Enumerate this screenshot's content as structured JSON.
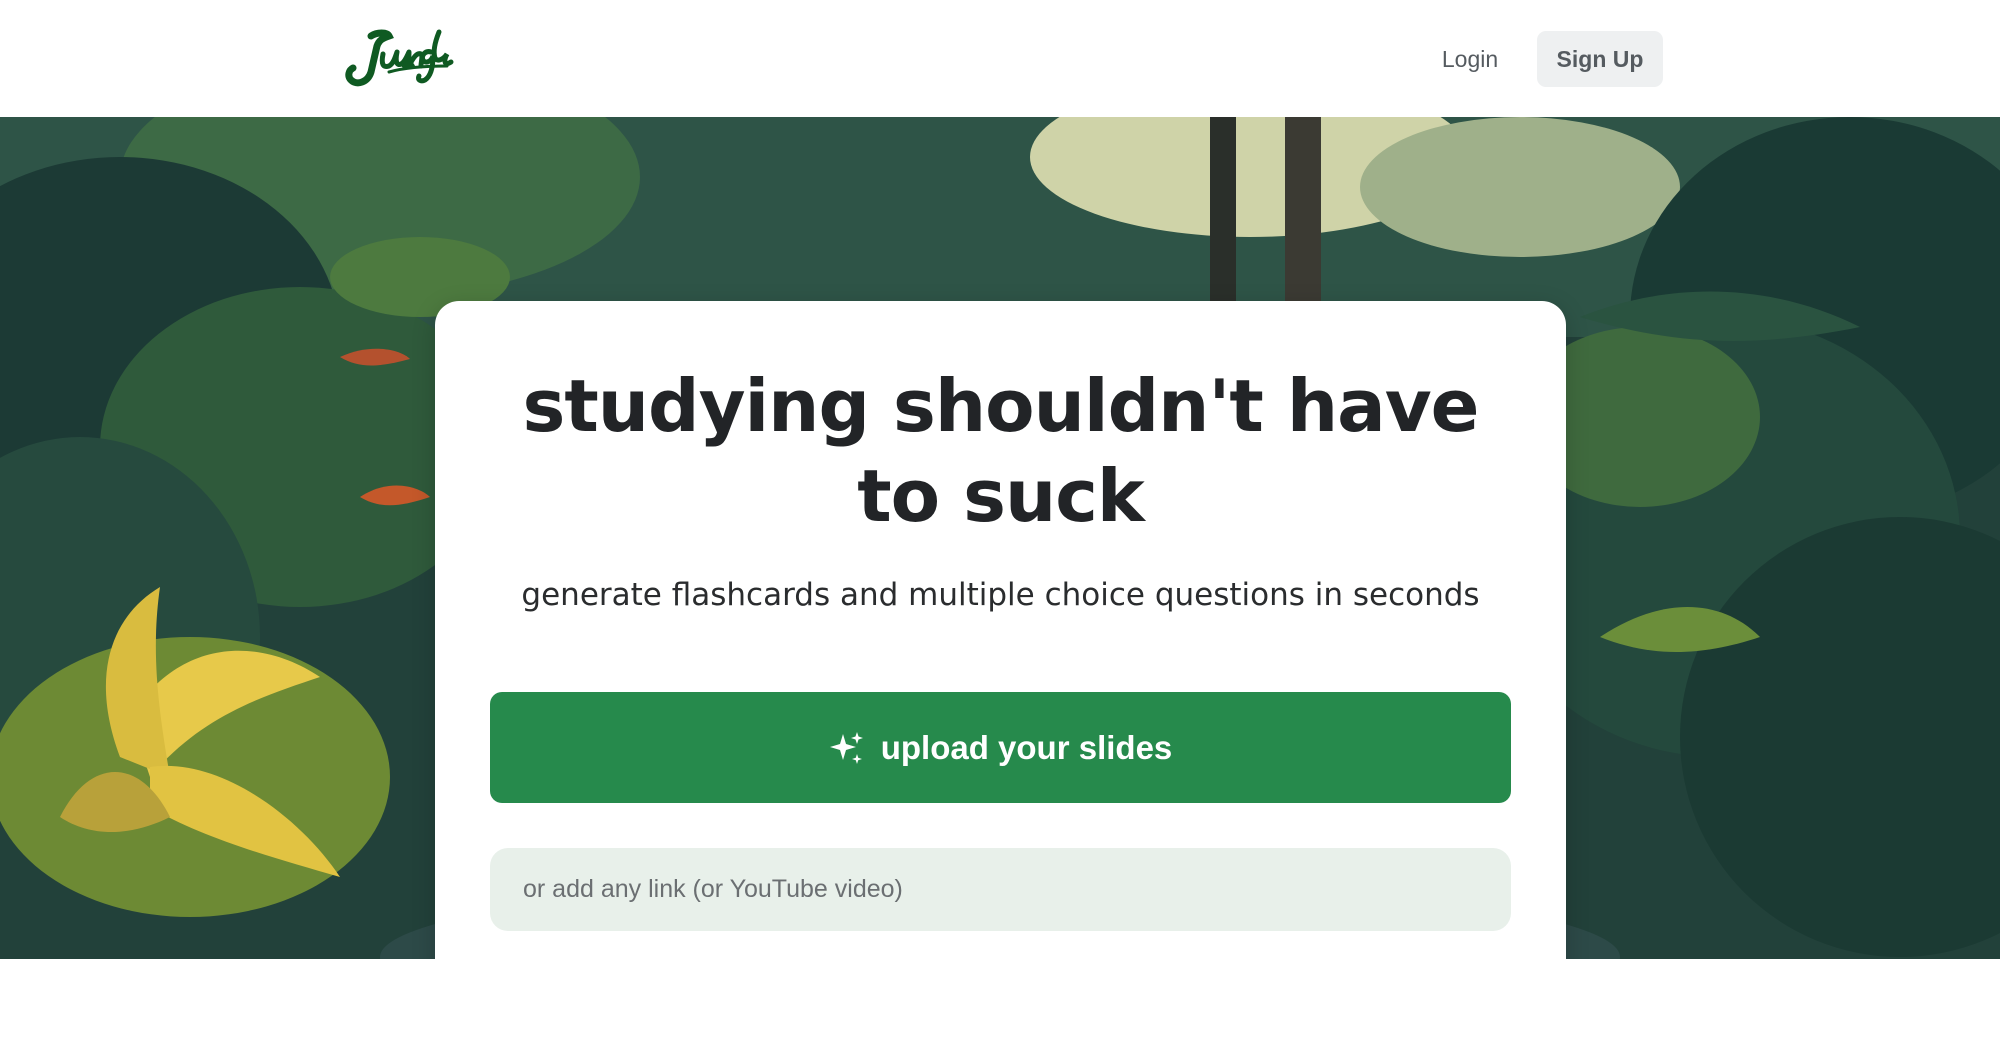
{
  "header": {
    "logo_icon": "jungle-logo",
    "logo_text": "Jungle",
    "login_label": "Login",
    "signup_label": "Sign Up"
  },
  "hero": {
    "background": "jungle-illustration",
    "headline": "studying shouldn't have to suck",
    "subheadline": "generate flashcards and multiple choice questions in seconds",
    "upload_icon": "sparkle-icon",
    "upload_label": "upload your slides",
    "link_placeholder": "or add any link (or YouTube video)"
  },
  "colors": {
    "brand_green": "#268a4c",
    "logo_green": "#0f5a22",
    "input_bg": "#e8f0ea",
    "signup_bg": "#eef0f1"
  }
}
